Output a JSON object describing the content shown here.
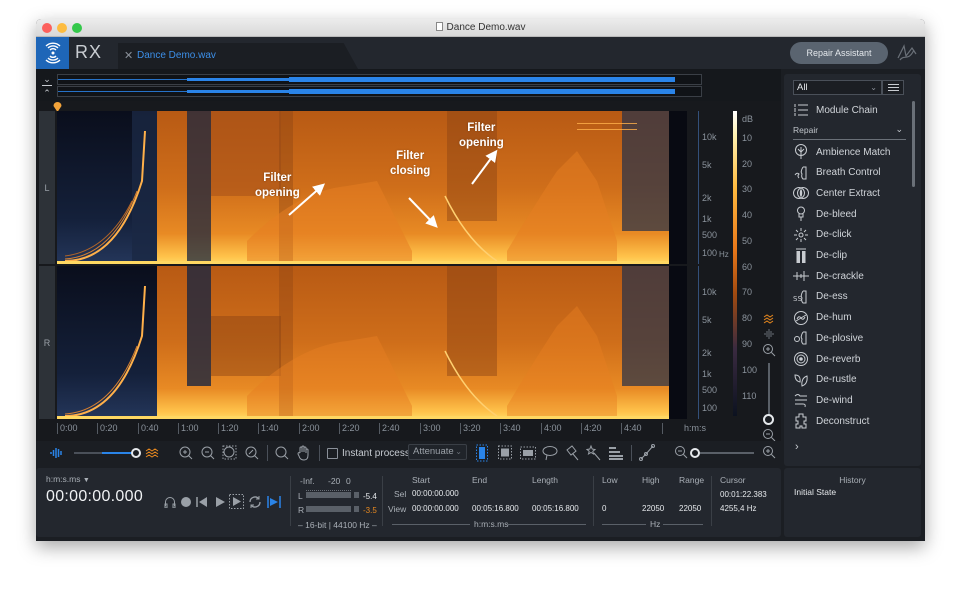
{
  "window": {
    "title": "Dance Demo.wav"
  },
  "app": {
    "name": "RX",
    "file_tab": "Dance Demo.wav",
    "repair_assistant_label": "Repair Assistant",
    "accent_color": "#2a84e8",
    "brand_color": "#1e66b8"
  },
  "spectrogram": {
    "channels": [
      "L",
      "R"
    ],
    "freq_ticks": [
      "10k",
      "5k",
      "2k",
      "1k",
      "500",
      "100"
    ],
    "freq_unit": "Hz",
    "db_unit": "dB",
    "db_ticks_top": [
      "10",
      "20",
      "30",
      "40",
      "50",
      "60"
    ],
    "db_ticks_bottom": [
      "70",
      "80",
      "90",
      "100",
      "110"
    ],
    "time_ticks": [
      "0:00",
      "0:20",
      "0:40",
      "1:00",
      "1:20",
      "1:40",
      "2:00",
      "2:20",
      "2:40",
      "3:00",
      "3:20",
      "3:40",
      "4:00",
      "4:20",
      "4:40"
    ],
    "time_unit": "h:m:s",
    "annotations": [
      {
        "line1": "Filter",
        "line2": "opening"
      },
      {
        "line1": "Filter",
        "line2": "closing"
      },
      {
        "line1": "Filter",
        "line2": "opening"
      }
    ]
  },
  "toolbar": {
    "instant_process_label": "Instant process",
    "instant_process_checked": false,
    "mode_value": "Attenuate",
    "spectrogram_waveform_blend": 1.0,
    "horizontal_zoom": 0.0
  },
  "modules": {
    "filter_value": "All",
    "module_chain_label": "Module Chain",
    "category_label": "Repair",
    "items": [
      {
        "label": "Ambience Match",
        "icon": "ambience-match-icon"
      },
      {
        "label": "Breath Control",
        "icon": "breath-control-icon"
      },
      {
        "label": "Center Extract",
        "icon": "center-extract-icon"
      },
      {
        "label": "De-bleed",
        "icon": "de-bleed-icon"
      },
      {
        "label": "De-click",
        "icon": "de-click-icon"
      },
      {
        "label": "De-clip",
        "icon": "de-clip-icon"
      },
      {
        "label": "De-crackle",
        "icon": "de-crackle-icon"
      },
      {
        "label": "De-ess",
        "icon": "de-ess-icon"
      },
      {
        "label": "De-hum",
        "icon": "de-hum-icon"
      },
      {
        "label": "De-plosive",
        "icon": "de-plosive-icon"
      },
      {
        "label": "De-reverb",
        "icon": "de-reverb-icon"
      },
      {
        "label": "De-rustle",
        "icon": "de-rustle-icon"
      },
      {
        "label": "De-wind",
        "icon": "de-wind-icon"
      },
      {
        "label": "Deconstruct",
        "icon": "deconstruct-icon"
      }
    ]
  },
  "transport": {
    "time_format": "h:m:s.ms",
    "current_time": "00:00:00.000"
  },
  "meters": {
    "scale_labels": [
      "-Inf.",
      "-20",
      "0"
    ],
    "left_label": "L",
    "right_label": "R",
    "left_peak": "-5.4",
    "right_peak": "-3.5",
    "right_peak_color": "#e8891f",
    "format": "16-bit | 44100 Hz"
  },
  "selection": {
    "headers": [
      "Start",
      "End",
      "Length"
    ],
    "rows": [
      {
        "label": "Sel",
        "start": "00:00:00.000",
        "end": "",
        "length": ""
      },
      {
        "label": "View",
        "start": "00:00:00.000",
        "end": "00:05:16.800",
        "length": "00:05:16.800"
      }
    ],
    "unit": "h:m:s.ms"
  },
  "frequency": {
    "headers": [
      "Low",
      "High",
      "Range"
    ],
    "low": "0",
    "high": "22050",
    "range": "22050",
    "unit": "Hz"
  },
  "cursor": {
    "label": "Cursor",
    "time": "00:01:22.383",
    "freq": "4255,4 Hz"
  },
  "history": {
    "title": "History",
    "items": [
      "Initial State"
    ]
  }
}
